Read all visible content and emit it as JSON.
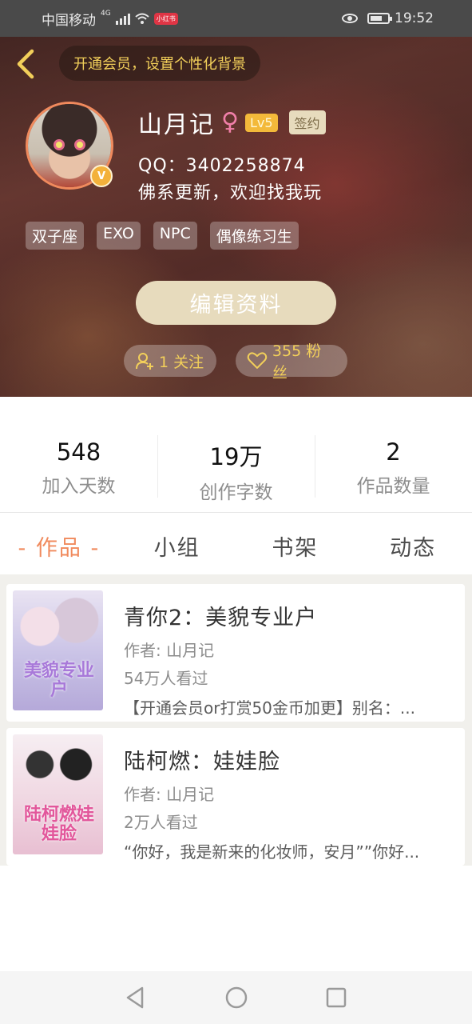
{
  "status_bar": {
    "carrier": "中国移动",
    "network": "4G",
    "app_badge": "小红书",
    "time": "19:52"
  },
  "header": {
    "vip_banner": "开通会员，设置个性化背景"
  },
  "profile": {
    "username": "山月记",
    "gender_symbol": "♀",
    "level": "Lv5",
    "sign_badge": "签约",
    "verified_mark": "V",
    "qq": "QQ：3402258874",
    "bio": "佛系更新，欢迎找我玩",
    "tags": [
      "双子座",
      "EXO",
      "NPC",
      "偶像练习生"
    ],
    "edit_button": "编辑资料",
    "follow": "1 关注",
    "fans": "355 粉丝"
  },
  "stats": [
    {
      "value": "548",
      "label": "加入天数"
    },
    {
      "value": "19万",
      "label": "创作字数"
    },
    {
      "value": "2",
      "label": "作品数量"
    }
  ],
  "tabs": [
    {
      "label": "- 作品 -",
      "active": true
    },
    {
      "label": "小组",
      "active": false
    },
    {
      "label": "书架",
      "active": false
    },
    {
      "label": "动态",
      "active": false
    }
  ],
  "books": [
    {
      "cover_text": "美貌专业户",
      "title": "青你2：美貌专业户",
      "author": "作者: 山月记",
      "views": "54万人看过",
      "description": "【开通会员or打赏50金币加更】别名：..."
    },
    {
      "cover_text": "陆柯燃娃娃脸",
      "title": "陆柯燃：娃娃脸",
      "author": "作者: 山月记",
      "views": "2万人看过",
      "description": "“你好，我是新来的化妆师，安月””你好..."
    }
  ],
  "colors": {
    "accent": "#f08a5d",
    "gold": "#f2cf5a",
    "badge_gold": "#f3b93a",
    "edit_button": "#e7dbbd"
  },
  "icons": {
    "back": "chevron-left-icon",
    "gender": "female-icon",
    "follow": "add-user-icon",
    "fans": "heart-icon",
    "nav_back": "triangle-back-icon",
    "nav_home": "circle-home-icon",
    "nav_recent": "square-recent-icon"
  }
}
